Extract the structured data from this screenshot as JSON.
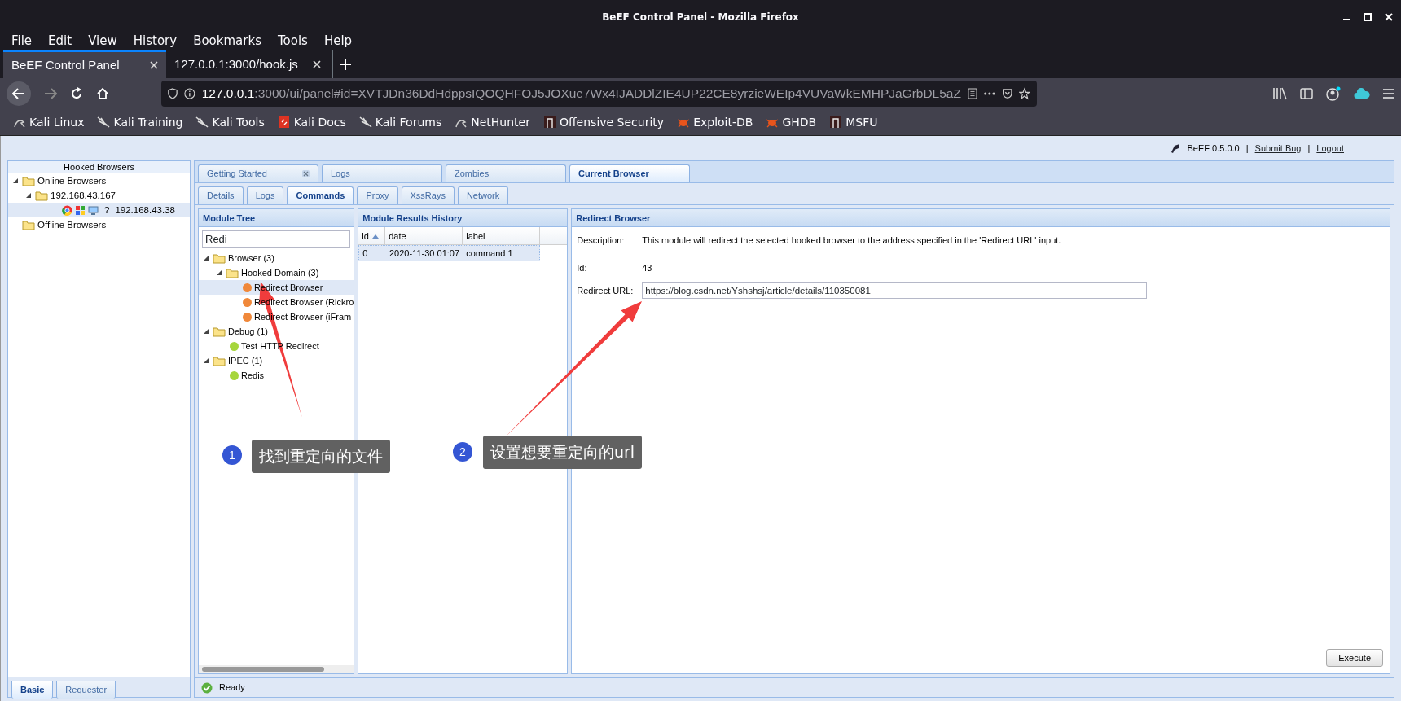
{
  "window": {
    "title": "BeEF Control Panel - Mozilla Firefox"
  },
  "menu": [
    "File",
    "Edit",
    "View",
    "History",
    "Bookmarks",
    "Tools",
    "Help"
  ],
  "browser_tabs": [
    {
      "label": "BeEF Control Panel",
      "selected": true
    },
    {
      "label": "127.0.0.1:3000/hook.js",
      "selected": false
    }
  ],
  "address": {
    "host": "127.0.0.1",
    "rest": ":3000/ui/panel#id=XVTJDn36DdHdppsIQOQHFOJ5JOXue7Wx4IJADDlZIE4UP22CE8yrzieWEIp4VUVaWkEMHPJaGrbDL5aZ"
  },
  "bookmarks": [
    {
      "label": "Kali Linux",
      "kind": "kali"
    },
    {
      "label": "Kali Training",
      "kind": "dragon"
    },
    {
      "label": "Kali Tools",
      "kind": "dragon"
    },
    {
      "label": "Kali Docs",
      "kind": "docs"
    },
    {
      "label": "Kali Forums",
      "kind": "dragon"
    },
    {
      "label": "NetHunter",
      "kind": "kali"
    },
    {
      "label": "Offensive Security",
      "kind": "offsec"
    },
    {
      "label": "Exploit-DB",
      "kind": "bug"
    },
    {
      "label": "GHDB",
      "kind": "bug"
    },
    {
      "label": "MSFU",
      "kind": "offsec"
    }
  ],
  "beef_header": {
    "version": "BeEF  0.5.0.0",
    "separator_1": "|",
    "submit_bug": "Submit  Bug",
    "separator_2": "|",
    "logout": "Logout"
  },
  "hooked_browsers": {
    "title": "Hooked Browsers",
    "tree": [
      {
        "label": "Online Browsers",
        "expanded": true,
        "children": [
          {
            "label": "192.168.43.167",
            "expanded": true,
            "children": [
              {
                "label": "192.168.43.38",
                "kind": "browser",
                "unknown_mark": "?",
                "selected": true
              }
            ]
          }
        ]
      },
      {
        "label": "Offline Browsers",
        "expanded": false
      }
    ]
  },
  "bottom_tabs": [
    {
      "label": "Basic",
      "selected": true
    },
    {
      "label": "Requester",
      "selected": false
    }
  ],
  "main_tabs": [
    {
      "label": "Getting Started",
      "selected": false,
      "closable": true
    },
    {
      "label": "Logs",
      "selected": false,
      "closable": false
    },
    {
      "label": "Zombies",
      "selected": false,
      "closable": false
    },
    {
      "label": "Current Browser",
      "selected": true,
      "closable": false
    }
  ],
  "sub_tabs": [
    {
      "label": "Details",
      "selected": false
    },
    {
      "label": "Logs",
      "selected": false
    },
    {
      "label": "Commands",
      "selected": true
    },
    {
      "label": "Proxy",
      "selected": false
    },
    {
      "label": "XssRays",
      "selected": false
    },
    {
      "label": "Network",
      "selected": false
    }
  ],
  "module_tree": {
    "title": "Module Tree",
    "search": "Redi",
    "tree": [
      {
        "label": "Browser (3)",
        "kind": "folder",
        "expanded": true,
        "children": [
          {
            "label": "Hooked Domain (3)",
            "kind": "folder",
            "expanded": true,
            "children": [
              {
                "label": "Redirect Browser",
                "kind": "module",
                "color": "#f0883a",
                "selected": true
              },
              {
                "label": "Redirect Browser (Rickro",
                "kind": "module",
                "color": "#f0883a",
                "selected": false
              },
              {
                "label": "Redirect Browser (iFram",
                "kind": "module",
                "color": "#f0883a",
                "selected": false
              }
            ]
          }
        ]
      },
      {
        "label": "Debug (1)",
        "kind": "folder",
        "expanded": true,
        "children": [
          {
            "label": "Test HTTP Redirect",
            "kind": "module",
            "color": "#a6d63c",
            "selected": false
          }
        ]
      },
      {
        "label": "IPEC (1)",
        "kind": "folder",
        "expanded": true,
        "children": [
          {
            "label": "Redis",
            "kind": "module",
            "color": "#a6d63c",
            "selected": false
          }
        ]
      }
    ]
  },
  "results": {
    "title": "Module Results History",
    "columns": [
      "id",
      "date",
      "label"
    ],
    "rows": [
      {
        "cells": [
          "0",
          "2020-11-30 01:07",
          "command 1"
        ],
        "selected": true
      }
    ]
  },
  "module_form": {
    "title": "Redirect Browser",
    "fields": [
      {
        "label": "Description:",
        "kind": "text",
        "value": "This module will redirect the selected hooked browser to the address specified in the 'Redirect URL' input."
      },
      {
        "label": "Id:",
        "kind": "text",
        "value": "43"
      },
      {
        "label": "Redirect URL:",
        "kind": "input",
        "value": "https://blog.csdn.net/Yshshsj/article/details/110350081"
      }
    ],
    "execute": "Execute"
  },
  "status_bar": {
    "text": "Ready"
  },
  "annotations": [
    {
      "number": "1",
      "text": "找到重定向的文件"
    },
    {
      "number": "2",
      "text": "设置想要重定向的url"
    }
  ]
}
